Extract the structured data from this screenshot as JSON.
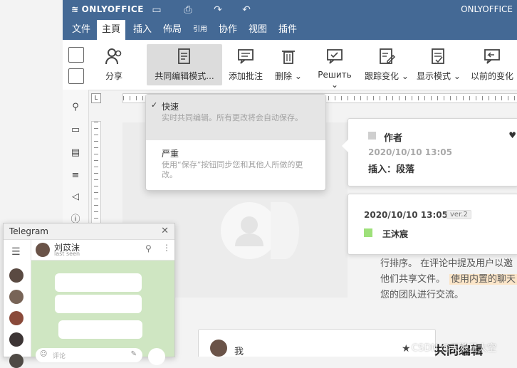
{
  "titlebar": {
    "logo_text": "ONLYOFFICE",
    "brand_text": "ONLYOFFICE"
  },
  "tabs": [
    {
      "label": "文件"
    },
    {
      "label": "主頁"
    },
    {
      "label": "插入"
    },
    {
      "label": "佈局"
    },
    {
      "label": "引用"
    },
    {
      "label": "协作"
    },
    {
      "label": "视图"
    },
    {
      "label": "插件"
    }
  ],
  "toolbar": {
    "share": "分享",
    "coedit_mode": "共同编辑模式...",
    "add_comment": "添加批注",
    "delete": "删除",
    "resolve": "Решить",
    "track_changes": "跟踪变化",
    "display_mode": "显示模式",
    "previous_change": "以前的变化"
  },
  "dropdown": {
    "fast": {
      "check": "✓",
      "title": "快速",
      "desc": "实时共同编辑。所有更改将会自动保存。"
    },
    "strict": {
      "title": "严重",
      "desc": "使用“保存”按钮同步您和其他人所做的更改。"
    }
  },
  "comment1": {
    "author": "作者",
    "date": "2020/10/10 13:05",
    "text": "插入：段落"
  },
  "comment2": {
    "date": "2020/10/10 13:05",
    "version": "ver.2",
    "user": "王沐宸"
  },
  "doc_text": {
    "line1": "行排序。 在评论中提及用户以邀",
    "line2a": "他们共享文件。",
    "line2b": "使用内置的聊天",
    "line3": "您的团队进行交流。"
  },
  "bottom": {
    "commenter": "我",
    "heading": "共同编辑",
    "watermark": "CSDN @天狼星太空"
  },
  "telegram": {
    "title": "Telegram",
    "contact_name": "刘苡沫",
    "contact_status": "last seen",
    "input_placeholder": "评论"
  },
  "colors": {
    "accent": "#446995",
    "highlight": "#fbe5c8",
    "user_green": "#9ee07a",
    "chat_bg": "#cfe6c2"
  }
}
